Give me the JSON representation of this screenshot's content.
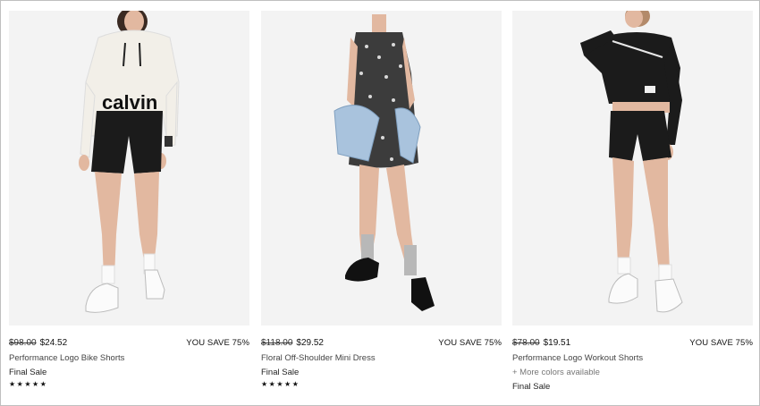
{
  "products": [
    {
      "original_price": "$98.00",
      "sale_price": "$24.52",
      "savings": "YOU SAVE 75%",
      "name": "Performance Logo Bike Shorts",
      "final_sale": "Final Sale",
      "rating_stars": "★★★★★"
    },
    {
      "original_price": "$118.00",
      "sale_price": "$29.52",
      "savings": "YOU SAVE 75%",
      "name": "Floral Off-Shoulder Mini Dress",
      "final_sale": "Final Sale",
      "rating_stars": "★★★★★"
    },
    {
      "original_price": "$78.00",
      "sale_price": "$19.51",
      "savings": "YOU SAVE 75%",
      "name": "Performance Logo Workout Shorts",
      "more_colors": "+ More colors available",
      "final_sale": "Final Sale"
    }
  ],
  "graphics": {
    "hoodie_print": "calvin"
  },
  "colors": {
    "photo_background": "#f3f3f3",
    "skin": "#e2b8a0",
    "black": "#1b1b1b",
    "cream": "#f2efe8",
    "denim": "#a9c3dd"
  }
}
